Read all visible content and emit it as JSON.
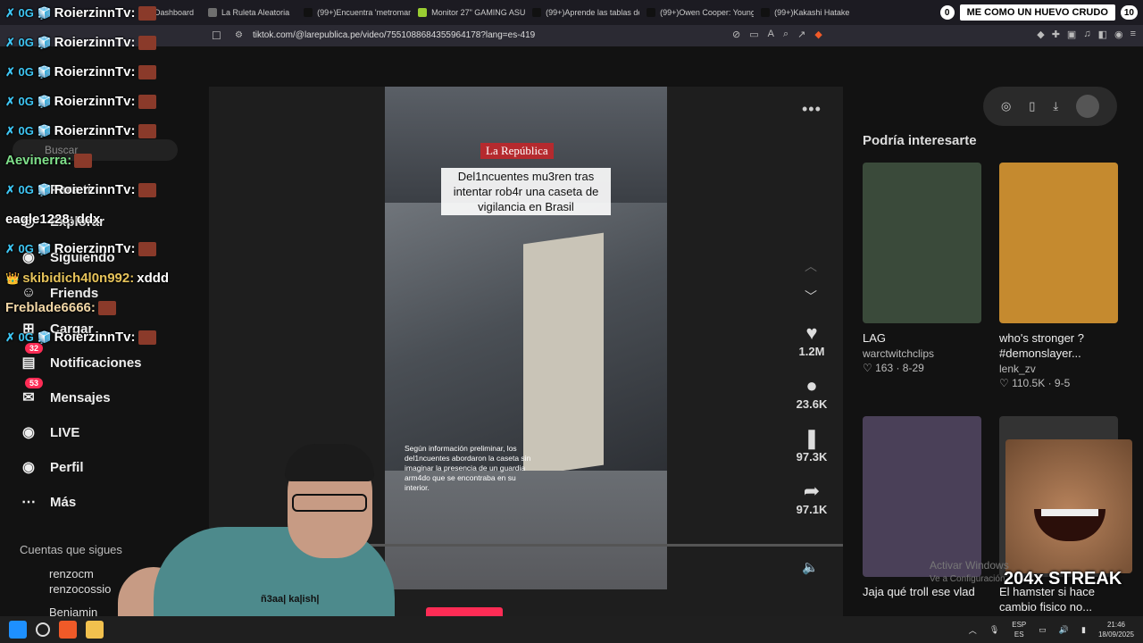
{
  "browser": {
    "tabs": [
      {
        "label": "Dashboard",
        "color": "#9146ff"
      },
      {
        "label": "La Ruleta Aleatoria",
        "color": "#6e6e6e"
      },
      {
        "label": "(99+)Encuentra 'metroman'",
        "color": "#111111"
      },
      {
        "label": "Monitor 27\" GAMING ASUS",
        "color": "#9acd32"
      },
      {
        "label": "(99+)Aprende las tablas de",
        "color": "#111111"
      },
      {
        "label": "(99+)Owen Cooper: Young",
        "color": "#111111"
      },
      {
        "label": "(99+)Kakashi Hatake",
        "color": "#111111"
      }
    ],
    "tab_counter_left": "0",
    "banner": "ME COMO UN HUEVO CRUDO",
    "tab_counter_right": "10",
    "url": "tiktok.com/@larepublica.pe/video/7551088684355964178?lang=es-419"
  },
  "sidebar": {
    "search_placeholder": "Buscar",
    "items": [
      {
        "label": "Para ti",
        "icon": "home-icon"
      },
      {
        "label": "Explorar",
        "icon": "compass-icon"
      },
      {
        "label": "Siguiendo",
        "icon": "following-icon"
      },
      {
        "label": "Friends",
        "icon": "friends-icon"
      },
      {
        "label": "Cargar",
        "icon": "upload-icon"
      },
      {
        "label": "Notificaciones",
        "icon": "inbox-icon",
        "badge": "32"
      },
      {
        "label": "Mensajes",
        "icon": "message-icon",
        "badge": "53"
      },
      {
        "label": "LIVE",
        "icon": "live-icon"
      },
      {
        "label": "Perfil",
        "icon": "profile-icon"
      },
      {
        "label": "Más",
        "icon": "more-icon"
      }
    ],
    "following_heading": "Cuentas que sigues",
    "following": [
      {
        "name": "renzocm",
        "handle": "renzocossio"
      },
      {
        "name": "Benjamin",
        "handle": ""
      }
    ]
  },
  "video": {
    "logo": "La República",
    "headline": "Del1ncuentes mu3ren tras intentar rob4r una caseta de vigilancia en Brasil",
    "caption": "Según información preliminar, los del1ncuentes abordaron la caseta sin imaginar la presencia de un guardia arm4do que se encontraba en su interior.",
    "progress": 0.22
  },
  "actions": [
    {
      "name": "like",
      "icon": "♥",
      "count": "1.2M"
    },
    {
      "name": "comment",
      "icon": "●",
      "count": "23.6K"
    },
    {
      "name": "save",
      "icon": "❚",
      "count": "97.3K"
    },
    {
      "name": "share",
      "icon": "➦",
      "count": "97.1K"
    }
  ],
  "recommended": {
    "title": "Podría interesarte",
    "items": [
      {
        "title": "LAG",
        "user": "warctwitchclips",
        "meta": "♡ 163 · 8-29",
        "color": "#3a4a3a"
      },
      {
        "title": "who's stronger ? #demonslayer...",
        "user": "lenk_zv",
        "meta": "♡ 110.5K · 9-5",
        "color": "#c58a2f"
      },
      {
        "title": "Jaja qué troll ese vlad",
        "user": "",
        "meta": "",
        "color": "#4a4058"
      },
      {
        "title": "El hamster si hace cambio fisico no...",
        "user": "",
        "meta": "",
        "color": "#333333"
      }
    ]
  },
  "chat": [
    {
      "user": "RoierzinnTv:",
      "color": "#ffffff",
      "badges": "✗ 0G 🧊",
      "text": ""
    },
    {
      "user": "RoierzinnTv:",
      "color": "#ffffff",
      "badges": "✗ 0G 🧊",
      "text": ""
    },
    {
      "user": "RoierzinnTv:",
      "color": "#ffffff",
      "badges": "✗ 0G 🧊",
      "text": ""
    },
    {
      "user": "RoierzinnTv:",
      "color": "#ffffff",
      "badges": "✗ 0G 🧊",
      "text": ""
    },
    {
      "user": "RoierzinnTv:",
      "color": "#ffffff",
      "badges": "✗ 0G 🧊",
      "text": ""
    },
    {
      "user": "Aevinerra:",
      "color": "#7fe08a",
      "badges": "",
      "text": ""
    },
    {
      "user": "RoierzinnTv:",
      "color": "#ffffff",
      "badges": "✗ 0G 🧊",
      "text": ""
    },
    {
      "user": "eagle1228:",
      "color": "#ffffff",
      "badges": "",
      "text": "ddx"
    },
    {
      "user": "RoierzinnTv:",
      "color": "#ffffff",
      "badges": "✗ 0G 🧊",
      "text": ""
    },
    {
      "user": "skibidich4l0n992:",
      "color": "#e6c35a",
      "badges": "👑",
      "text": "xddd"
    },
    {
      "user": "Freblade6666:",
      "color": "#f2d7a6",
      "badges": "",
      "text": ""
    },
    {
      "user": "RoierzinnTv:",
      "color": "#ffffff",
      "badges": "✗ 0G 🧊",
      "text": ""
    }
  ],
  "overlay": {
    "streak": "204x STREAK",
    "watermark_title": "Activar Windows",
    "watermark_sub": "Ve a Configuración",
    "shirt_text": "ñ3aa| ka|ish|"
  },
  "taskbar": {
    "lang_top": "ESP",
    "lang_bottom": "ES",
    "time": "21:46",
    "date": "18/09/2025"
  }
}
